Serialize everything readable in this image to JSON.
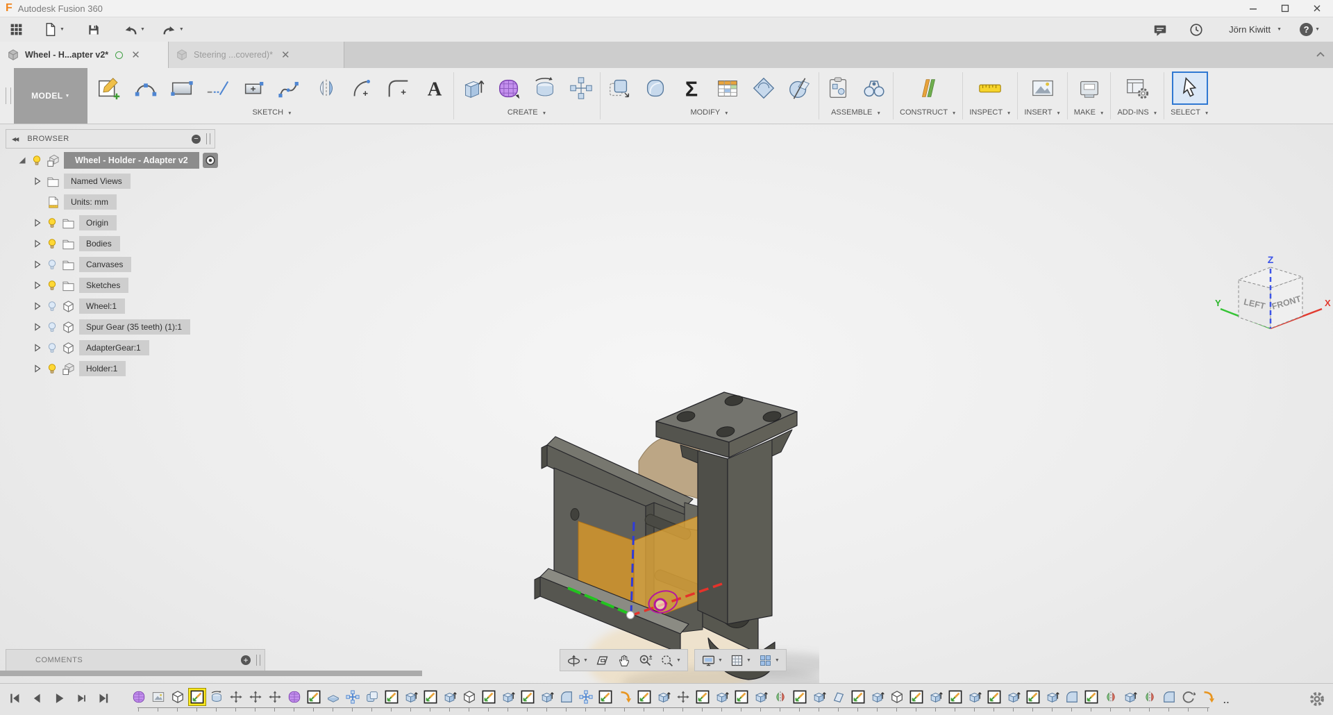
{
  "window": {
    "title": "Autodesk Fusion 360",
    "controls": [
      "minimize",
      "restore",
      "close"
    ]
  },
  "appbar": {
    "caret": "▼",
    "left_tools": [
      "app-grid",
      "file-new",
      "save",
      "undo",
      "redo"
    ],
    "right_tools": [
      "comments-bubble",
      "job-status-clock"
    ],
    "user": "Jörn Kiwitt",
    "help_label": "?"
  },
  "tabs": [
    {
      "label": "Wheel - H...apter v2*",
      "active": true,
      "has_sync_dot": true
    },
    {
      "label": "Steering ...covered)*",
      "active": false,
      "has_sync_dot": false
    }
  ],
  "ribbon": {
    "workspace_label": "MODEL",
    "caret": "▼",
    "groups": [
      {
        "label": "SKETCH",
        "icons": [
          "create-sketch",
          "arc-3pt",
          "rectangle",
          "line",
          "rect-center",
          "spline",
          "mirror",
          "arc",
          "fillet-2d",
          "text"
        ]
      },
      {
        "label": "CREATE",
        "icons": [
          "extrude",
          "form",
          "revolve",
          "pattern"
        ]
      },
      {
        "label": "MODIFY",
        "icons": [
          "press-pull",
          "fillet",
          "parameters-sigma",
          "change-parameters",
          "sweep",
          "split-body"
        ]
      },
      {
        "label": "ASSEMBLE",
        "icons": [
          "new-component",
          "joint"
        ]
      },
      {
        "label": "CONSTRUCT",
        "icons": [
          "plane"
        ]
      },
      {
        "label": "INSPECT",
        "icons": [
          "measure"
        ]
      },
      {
        "label": "INSERT",
        "icons": [
          "insert-image"
        ]
      },
      {
        "label": "MAKE",
        "icons": [
          "make-3d-print"
        ]
      },
      {
        "label": "ADD-INS",
        "icons": [
          "scripts-addins"
        ]
      },
      {
        "label": "SELECT",
        "icons": [
          "select-cursor"
        ],
        "selected": true
      }
    ]
  },
  "browser": {
    "title": "BROWSER",
    "root": {
      "label": "Wheel - Holder - Adapter v2",
      "bulb": "on",
      "icon": "component"
    },
    "items": [
      {
        "label": "Named Views",
        "icon": "folder",
        "bulb": null,
        "arrow": true
      },
      {
        "label": "Units: mm",
        "icon": "units",
        "bulb": null,
        "arrow": false
      },
      {
        "label": "Origin",
        "icon": "folder",
        "bulb": "on",
        "arrow": true
      },
      {
        "label": "Bodies",
        "icon": "folder",
        "bulb": "on",
        "arrow": true
      },
      {
        "label": "Canvases",
        "icon": "folder",
        "bulb": "off",
        "arrow": true
      },
      {
        "label": "Sketches",
        "icon": "folder",
        "bulb": "on",
        "arrow": true
      },
      {
        "label": "Wheel:1",
        "icon": "body",
        "bulb": "off",
        "arrow": true
      },
      {
        "label": "Spur Gear (35 teeth) (1):1",
        "icon": "body",
        "bulb": "off",
        "arrow": true
      },
      {
        "label": "AdapterGear:1",
        "icon": "body",
        "bulb": "off",
        "arrow": true
      },
      {
        "label": "Holder:1",
        "icon": "component",
        "bulb": "on",
        "arrow": true
      }
    ]
  },
  "viewcube": {
    "z_label": "Z",
    "y_label": "Y",
    "x_label": "X",
    "left_face": "LEFT",
    "front_face": "FRONT"
  },
  "comments": {
    "title": "COMMENTS"
  },
  "navbar": {
    "group1": [
      {
        "name": "orbit",
        "caret": true
      },
      {
        "name": "look-at",
        "caret": false
      },
      {
        "name": "pan",
        "caret": false
      },
      {
        "name": "zoom",
        "caret": false
      },
      {
        "name": "fit",
        "caret": true
      }
    ],
    "group2": [
      {
        "name": "display-settings",
        "caret": true
      },
      {
        "name": "layout-grid",
        "caret": true
      },
      {
        "name": "viewports",
        "caret": true
      }
    ]
  },
  "timeline": {
    "selected_index": 3,
    "overflow_label": "..",
    "icons": [
      "form",
      "canvas",
      "body",
      "sketch",
      "revolve",
      "move",
      "move",
      "move",
      "form",
      "sketch",
      "chamfer",
      "joint",
      "combine",
      "sketch",
      "extrude",
      "sketch",
      "extrude",
      "body",
      "sketch",
      "extrude",
      "sketch",
      "extrude",
      "fillet",
      "joint",
      "sketch",
      "hole",
      "sketch",
      "extrude",
      "move",
      "sketch",
      "extrude",
      "sketch",
      "extrude",
      "mirror",
      "sketch",
      "extrude",
      "plane",
      "sketch",
      "extrude",
      "body",
      "sketch",
      "extrude",
      "sketch",
      "extrude",
      "sketch",
      "extrude",
      "sketch",
      "extrude",
      "fillet",
      "sketch",
      "mirror",
      "extrude",
      "mirror",
      "fillet",
      "link",
      "hole"
    ]
  },
  "colors": {
    "accent_blue": "#2f78d2",
    "selection_orange": "#e8a33d",
    "timeline_selected_yellow": "#ffe91f",
    "form_purple": "#b57ee5",
    "axis_x": "#e5322a",
    "axis_y": "#22c41f",
    "axis_z": "#2f3bd8",
    "joint_magenta": "#b5179e",
    "sync_green": "#43a047"
  }
}
